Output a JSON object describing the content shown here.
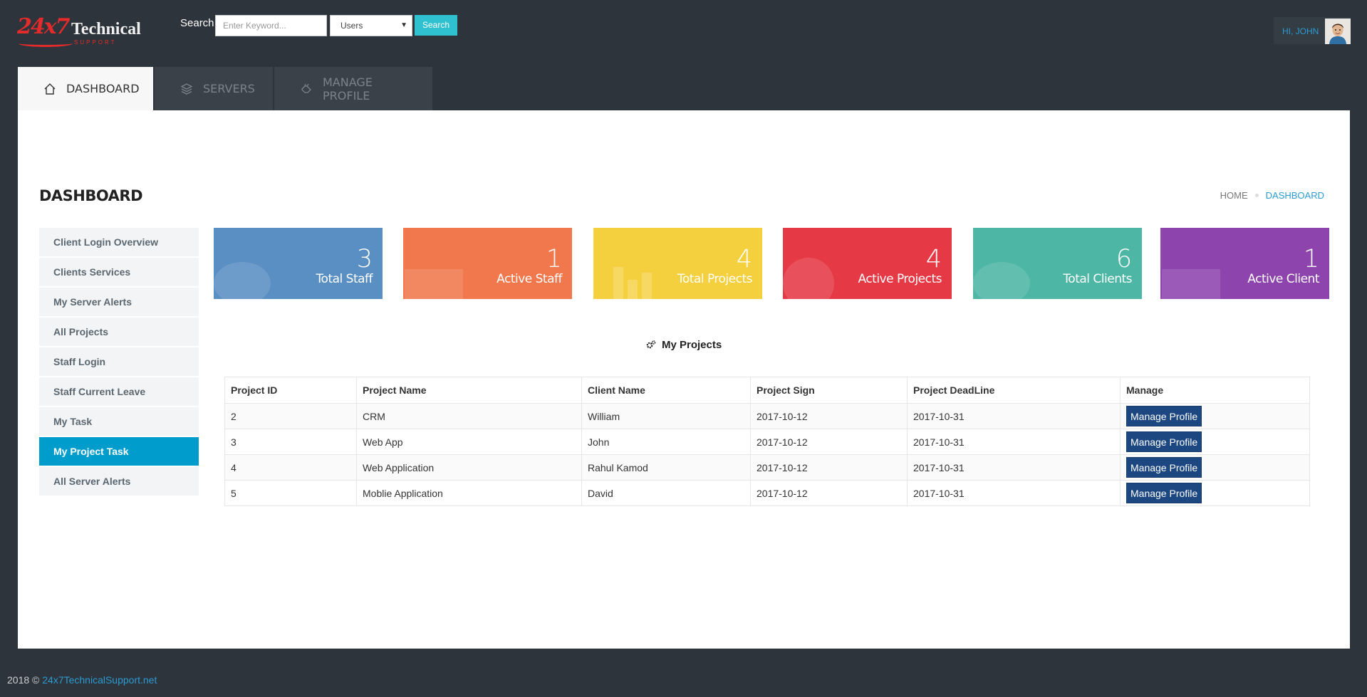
{
  "header": {
    "logo_num": "24x7",
    "logo_text": "Technical",
    "logo_sub": "SUPPORT",
    "search_label": "Search",
    "search_placeholder": "Enter Keyword...",
    "search_select_value": "Users",
    "search_button": "Search",
    "greeting": "HI, JOHN"
  },
  "tabs": [
    {
      "label": "DASHBOARD",
      "icon": "home-icon",
      "active": true
    },
    {
      "label": "SERVERS",
      "icon": "layers-icon",
      "active": false
    },
    {
      "label": "MANAGE PROFILE",
      "icon": "hand-icon",
      "active": false
    }
  ],
  "page": {
    "title": "DASHBOARD",
    "breadcrumb": [
      "HOME",
      "DASHBOARD"
    ]
  },
  "sidebar": {
    "items": [
      {
        "label": "Client Login Overview"
      },
      {
        "label": "Clients Services"
      },
      {
        "label": "My Server Alerts"
      },
      {
        "label": "All Projects"
      },
      {
        "label": "Staff Login"
      },
      {
        "label": "Staff Current Leave"
      },
      {
        "label": "My Task"
      },
      {
        "label": "My Project Task",
        "active": true
      },
      {
        "label": "All Server Alerts"
      }
    ]
  },
  "tiles": [
    {
      "value": "3",
      "label": "Total Staff",
      "color": "#5a8fc3"
    },
    {
      "value": "1",
      "label": "Active Staff",
      "color": "#f1784d"
    },
    {
      "value": "4",
      "label": "Total Projects",
      "color": "#f4d03f"
    },
    {
      "value": "4",
      "label": "Active Projects",
      "color": "#e53a46"
    },
    {
      "value": "6",
      "label": "Total Clients",
      "color": "#4db6a4"
    },
    {
      "value": "1",
      "label": "Active Client",
      "color": "#8e44ad"
    }
  ],
  "projects": {
    "title": "My Projects",
    "columns": [
      "Project ID",
      "Project Name",
      "Client Name",
      "Project Sign",
      "Project DeadLine",
      "Manage"
    ],
    "rows": [
      {
        "id": "2",
        "name": "CRM",
        "client": "William",
        "sign": "2017-10-12",
        "deadline": "2017-10-31",
        "action": "Manage Profile"
      },
      {
        "id": "3",
        "name": "Web App",
        "client": "John",
        "sign": "2017-10-12",
        "deadline": "2017-10-31",
        "action": "Manage Profile"
      },
      {
        "id": "4",
        "name": "Web Application",
        "client": "Rahul Kamod",
        "sign": "2017-10-12",
        "deadline": "2017-10-31",
        "action": "Manage Profile"
      },
      {
        "id": "5",
        "name": "Moblie Application",
        "client": "David",
        "sign": "2017-10-12",
        "deadline": "2017-10-31",
        "action": "Manage Profile"
      }
    ]
  },
  "footer": {
    "prefix": "2018 ©",
    "link": "24x7TechnicalSupport.net"
  }
}
